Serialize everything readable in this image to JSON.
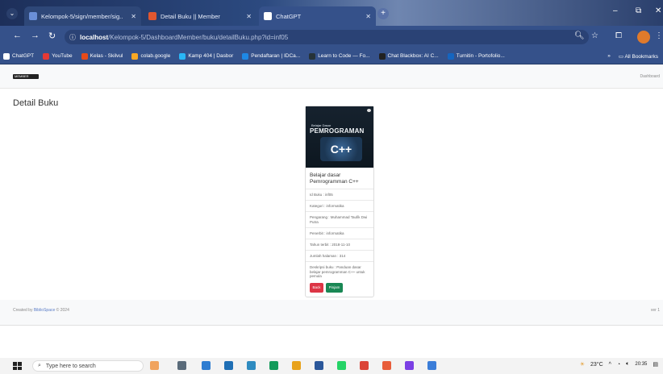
{
  "browser": {
    "tabs": [
      {
        "label": "Kelompok-5/sign/member/sig..",
        "color": "#6a8fd8"
      },
      {
        "label": "Detail Buku || Member",
        "color": "#e1572f"
      },
      {
        "label": "ChatGPT",
        "color": "#ffffff"
      }
    ],
    "window_controls": {
      "minimize": "–",
      "restore": "⧉",
      "close": "✕"
    },
    "url_host": "localhost",
    "url_path": "/Kelompok-5/DashboardMember/buku/detailBuku.php?id=inf05",
    "bookmarks": [
      {
        "label": "ChatGPT",
        "color": "#ffffff"
      },
      {
        "label": "YouTube",
        "color": "#e53935"
      },
      {
        "label": "Kelas - Skilvul",
        "color": "#e64a19"
      },
      {
        "label": "colab.google",
        "color": "#f9a825"
      },
      {
        "label": "Kamp 404 | Dasbor",
        "color": "#29b6f6"
      },
      {
        "label": "Pendaftaran | IDCa...",
        "color": "#1e88e5"
      },
      {
        "label": "Learn to Code — Fo...",
        "color": "#263238"
      },
      {
        "label": "Chat Blackbox: AI C...",
        "color": "#212121"
      },
      {
        "label": "Turnitin - Portofolio...",
        "color": "#1565c0"
      }
    ],
    "bookmarks_more": "»",
    "all_bookmarks": "All Bookmarks"
  },
  "app": {
    "logo_text": "MEMBER",
    "nav_right": "Dashboard",
    "page_title": "Detail Buku",
    "book": {
      "cover_series": "Belajar Dasar",
      "cover_title": "PEMROGRAMAN",
      "cover_lang": "C++",
      "title": "Belajar dasar Pemrogramman C++",
      "details": [
        "Id Buku : inf05",
        "Kategori : informatika",
        "Pengarang : Muhammad Taufik Dwi Putra",
        "Penerbit : informatika",
        "Tahun terbit : 2018-11-10",
        "Jumlah halaman : 314",
        "Deskripsi buku : Panduan dasar belajar pemrogramman C++ untuk pemula"
      ],
      "buttons": {
        "back": "Back",
        "pinjam": "Pinjam"
      }
    },
    "footer": {
      "prefix": "Created by ",
      "author": "BiblioSpace",
      "suffix": " © 2024",
      "version": "ver 1"
    }
  },
  "taskbar": {
    "search_placeholder": "Type here to search",
    "weather": "23°C",
    "time": "20:35"
  }
}
